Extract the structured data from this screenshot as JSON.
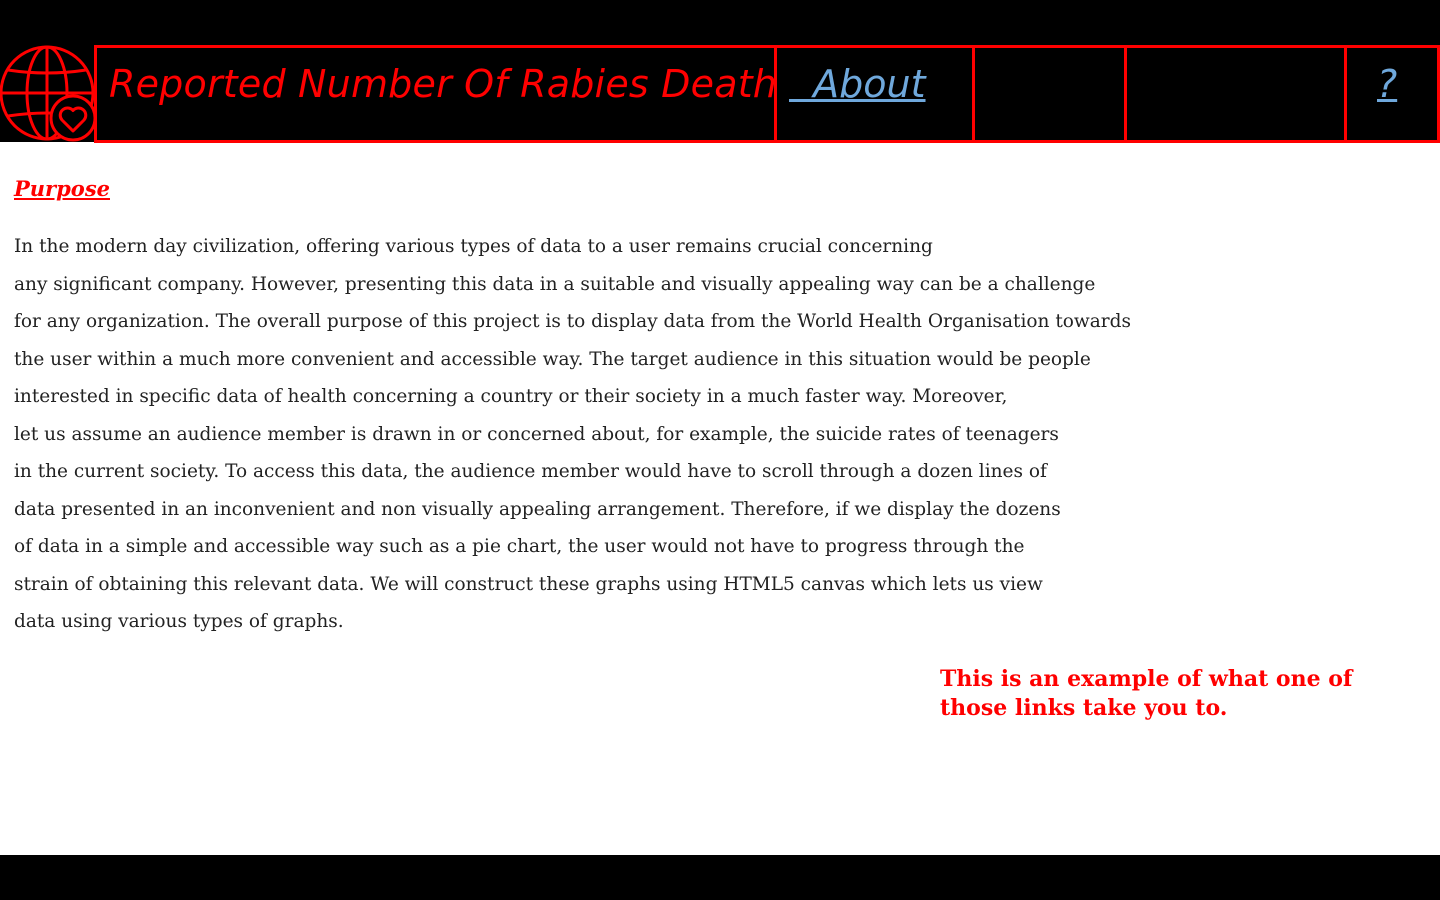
{
  "header": {
    "site_title": "Reported Number Of Rabies Deaths",
    "logo_icon": "globe-heart-icon",
    "nav": {
      "about_label": "  About",
      "help_label": "?"
    }
  },
  "main": {
    "heading": "Purpose",
    "paragraph_lines": [
      "In the modern day civilization, offering various types of data to a user remains crucial concerning",
      "any significant company. However, presenting this data in a suitable and visually appealing way can be a challenge",
      "for any organization. The overall purpose of this project is to display data from the World Health Organisation towards",
      "the user within a much more convenient and accessible way. The target audience in this situation would be people",
      "interested in specific data of health concerning a country or their society in a much faster way. Moreover,",
      "let us assume an audience member is drawn in or concerned about, for example, the suicide rates of teenagers",
      "in the current society. To access this data, the audience member would have to scroll through a dozen lines of",
      "data presented in an inconvenient and non visually appealing arrangement. Therefore, if we display the dozens",
      "of data in a simple and accessible way such as a pie chart, the user would not have to progress through the",
      "strain of obtaining this relevant data. We will construct these graphs using HTML5 canvas which lets us view",
      "data using various types of graphs."
    ],
    "example_note": "This is an example of what one of those links take you to."
  },
  "colors": {
    "accent": "#ff0000",
    "link": "#6fa8dc",
    "header_bg": "#000000",
    "body_text": "#222222"
  }
}
